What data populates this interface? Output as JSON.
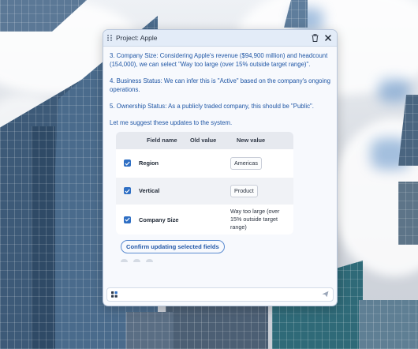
{
  "window": {
    "title": "Project: Apple",
    "icons": [
      "drag-handle-icon",
      "trash-icon",
      "close-icon"
    ]
  },
  "message": {
    "paragraphs": [
      "3. Company Size: Considering Apple's revenue ($94,900 million) and headcount (154,000), we can select \"Way too large (over 15% outside target range)\".",
      "4. Business Status: We can infer this is \"Active\" based on the company's ongoing operations.",
      "5. Ownership Status: As a publicly traded company, this should be \"Public\".",
      "Let me suggest these updates to the system."
    ]
  },
  "table": {
    "headers": {
      "field": "Field name",
      "old": "Old value",
      "new": "New value"
    },
    "rows": [
      {
        "checked": true,
        "field": "Region",
        "old": "",
        "new": "Americas"
      },
      {
        "checked": true,
        "field": "Vertical",
        "old": "",
        "new": "Product"
      },
      {
        "checked": true,
        "field": "Company Size",
        "old": "",
        "new": "Way too large (over 15% outside target range)"
      }
    ]
  },
  "actions": {
    "confirm_label": "Confirm updating selected fields"
  },
  "composer": {
    "value": "",
    "placeholder": "",
    "icons": [
      "apps-icon",
      "send-icon"
    ]
  },
  "colors": {
    "accent": "#2f6fc4",
    "message_text": "#1f56a5",
    "titlebar": "#e3ecf8"
  }
}
